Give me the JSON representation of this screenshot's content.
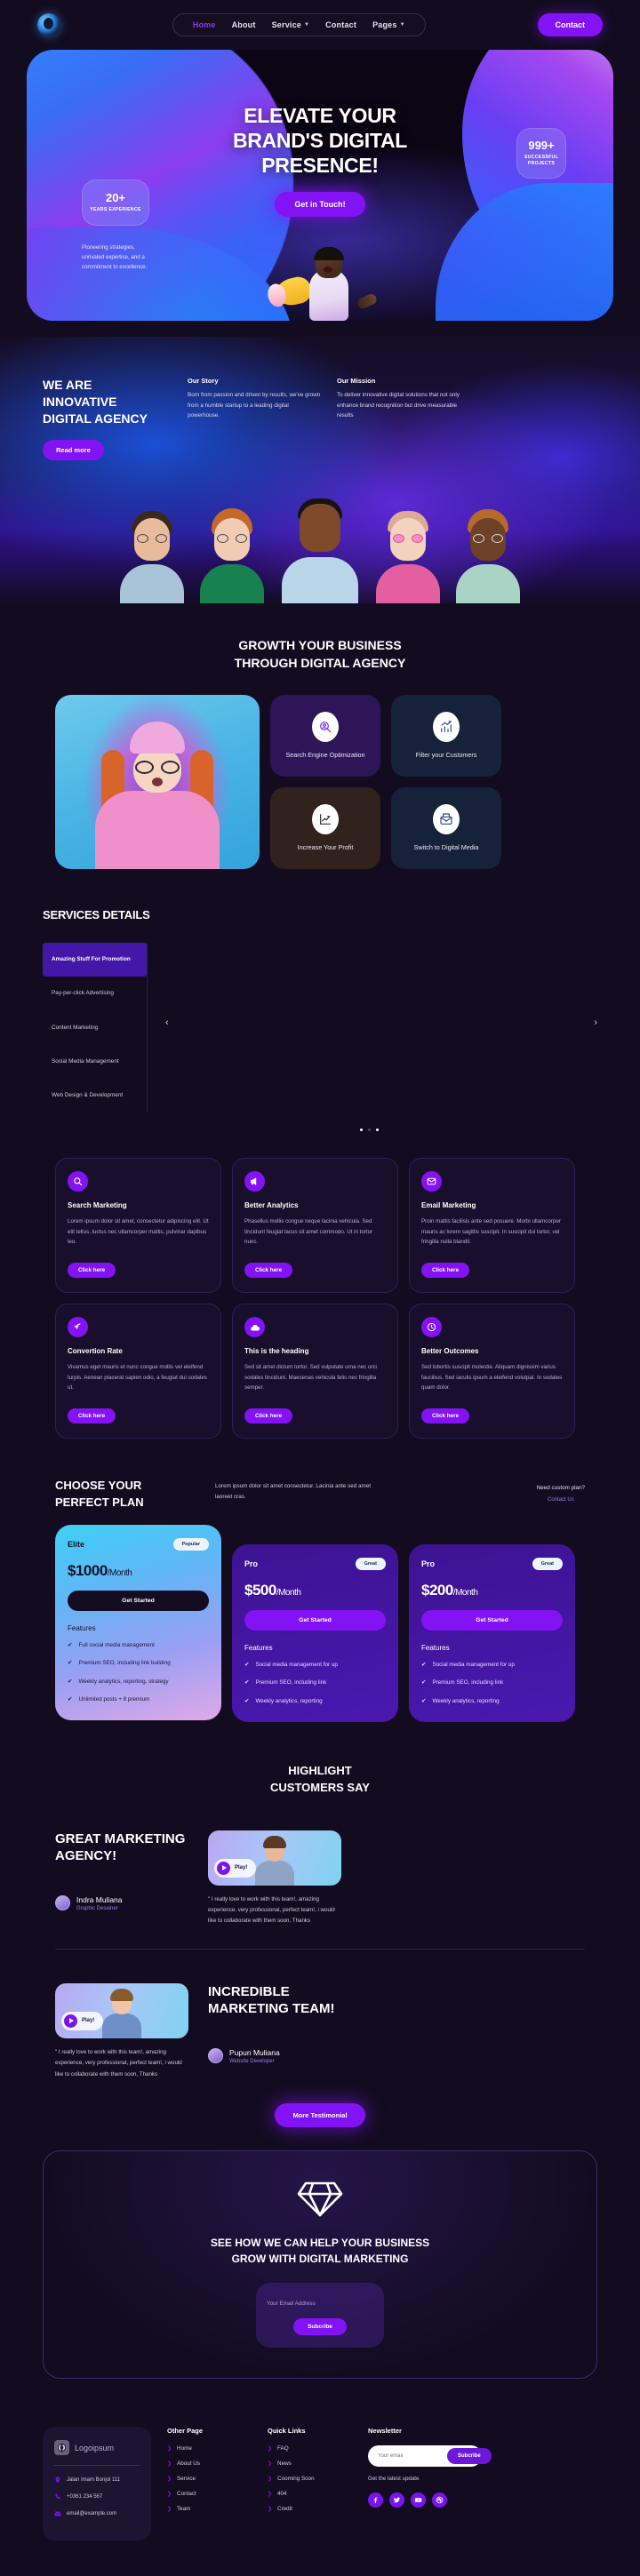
{
  "header": {
    "logo_name": "agency-logo",
    "nav": [
      {
        "label": "Home",
        "active": true,
        "caret": false
      },
      {
        "label": "About",
        "active": false,
        "caret": false
      },
      {
        "label": "Service",
        "active": false,
        "caret": true
      },
      {
        "label": "Contact",
        "active": false,
        "caret": false
      },
      {
        "label": "Pages",
        "active": false,
        "caret": true
      }
    ],
    "cta_label": "Contact"
  },
  "hero": {
    "title_line1": "ELEVATE YOUR",
    "title_line2": "BRAND'S DIGITAL",
    "title_line3": "PRESENCE!",
    "button": "Get in Touch!",
    "stat_projects_num": "999+",
    "stat_projects_label": "SUCCESSFUL PROJECTS",
    "stat_years_num": "20+",
    "stat_years_label": "YEARS EXPERIENCE",
    "subtext": "Pioneering strategies, unrivaled expertise, and a commitment to excellence."
  },
  "about": {
    "heading_l1": "WE ARE",
    "heading_l2": "INNOVATIVE",
    "heading_l3": "DIGITAL AGENCY",
    "button": "Read more",
    "columns": [
      {
        "title": "Our Story",
        "text": "Born from passion and driven by results, we've grown from a humble startup to a leading digital powerhouse."
      },
      {
        "title": "Our Mission",
        "text": "To deliver innovative digital solutions that not only enhance brand recognition but drive measurable results"
      }
    ]
  },
  "growth": {
    "title_l1": "GROWTH YOUR BUSINESS",
    "title_l2": "THROUGH DIGITAL AGENCY",
    "cards": [
      {
        "label": "Search Engine Optimization",
        "icon": "magnify-person-icon"
      },
      {
        "label": "Filter your Customers",
        "icon": "bar-chart-growth-icon"
      },
      {
        "label": "Increase Your Profit",
        "icon": "line-chart-up-icon"
      },
      {
        "label": "Switch to Digital Media",
        "icon": "envelope-doc-icon"
      }
    ]
  },
  "services_details": {
    "title": "SERVICES DETAILS",
    "items": [
      {
        "label": "Amazing Stuff For Promotion",
        "active": true
      },
      {
        "label": "Pay-per-click Advertising",
        "active": false
      },
      {
        "label": "Content Marketing",
        "active": false
      },
      {
        "label": "Social Media Management",
        "active": false
      },
      {
        "label": "Web Design & Development",
        "active": false
      }
    ],
    "prev_icon": "‹",
    "next_icon": "›"
  },
  "service_cards": [
    {
      "icon": "search-icon",
      "title": "Search Marketing",
      "text": "Lorem ipsum dolor sit amet, consectetur adipiscing elit. Ut elit tellus, luctus nec ullamcorper mattis, pulvinar dapibus leo.",
      "button": "Click here"
    },
    {
      "icon": "megaphone-icon",
      "title": "Better Analytics",
      "text": "Phasellus mollis congue neque lacinia vehicula. Sed tincidunt feugiat lacus sit amet commodo. Ut in tortor nunc.",
      "button": "Click here"
    },
    {
      "icon": "envelope-icon",
      "title": "Email Marketing",
      "text": "Proin mattis facilisis ante sed posuere. Morbi ullamcorper mauris ac lorem sagittis suscipit. In suscipit dui tortor, vel fringilla nulla blandit.",
      "button": "Click here"
    },
    {
      "icon": "rocket-icon",
      "title": "Convertion Rate",
      "text": "Vivamus eget mauris et nunc congue mollis vel eleifend turpis. Aenean placerat sapien odio, a feugiat dui sodales ut.",
      "button": "Click here"
    },
    {
      "icon": "cloud-icon",
      "title": "This is the heading",
      "text": "Sed sit amet dictum tortor. Sed vulputate urna nec orci sodales tincidunt. Maecenas vehicula felis nec fringilla semper.",
      "button": "Click here"
    },
    {
      "icon": "clock-icon",
      "title": "Better Outcomes",
      "text": "Sed lobortis suscipit molestie. Aliquam dignissim varius faucibus. Sed iaculis ipsum a eleifend volutpat. In sodales quam dolor.",
      "button": "Click here"
    }
  ],
  "pricing": {
    "title_l1": "CHOOSE YOUR",
    "title_l2": "PERFECT PLAN",
    "description": "Lorem ipsum dolor sit amet consectetur. Lacinia ante sed amet laoreet cras.",
    "custom_question": "Need custom plan?",
    "custom_link": "Contact Us",
    "features_label": "Features",
    "plans": [
      {
        "name": "Elite",
        "badge": "Popular",
        "price": "$1000",
        "period": "/Month",
        "button": "Get Started",
        "features": [
          "Full social media management",
          "Premium SEO, including link building",
          "Weekly analytics, reporting, strategy",
          "Unlimited posts + 8 premium"
        ]
      },
      {
        "name": "Pro",
        "badge": "Great",
        "price": "$500",
        "period": "/Month",
        "button": "Get Started",
        "features": [
          "Social media management for up",
          "Premium SEO, including link",
          "Weekly analytics, reporting"
        ]
      },
      {
        "name": "Pro",
        "badge": "Great",
        "price": "$200",
        "period": "/Month",
        "button": "Get Started",
        "features": [
          "Social media management for up",
          "Premium SEO, including link",
          "Weekly analytics, reporting"
        ]
      }
    ]
  },
  "testimonials": {
    "title_l1": "HIGHLIGHT",
    "title_l2": "CUSTOMERS SAY",
    "play_label": "Play!",
    "items": [
      {
        "heading": "GREAT MARKETING AGENCY!",
        "name": "Indra Muliana",
        "role": "Graphic Desainer",
        "quote": "\" I really love to work with this team!, amazing experience, very professional, perfect team!, i would like to collaborate with them soon, Thanks"
      },
      {
        "heading": "INCREDIBLE MARKETING TEAM!",
        "name": "Pupun Muliana",
        "role": "Website Developer",
        "quote": "\" I really love to work with this team!, amazing experience, very professional, perfect team!, i would like to collaborate with them soon, Thanks"
      }
    ],
    "more_button": "More Testimonial"
  },
  "cta": {
    "icon": "diamond-icon",
    "heading_l1": "SEE HOW WE CAN HELP YOUR BUSINESS",
    "heading_l2": "GROW WITH DIGITAL MARKETING",
    "placeholder": "Your Email Address",
    "button": "Subcribe"
  },
  "footer": {
    "brand": "Logoipsum",
    "address": "Jalan Imam Bonjol 111",
    "phone": "+0361 234 567",
    "email": "email@example.com",
    "other_page_title": "Other Page",
    "other_page": [
      "Home",
      "About Us",
      "Service",
      "Contact",
      "Team"
    ],
    "quick_links_title": "Quick Links",
    "quick_links": [
      "FAQ",
      "News",
      "Cooming Soon",
      "404",
      "Credit"
    ],
    "newsletter_title": "Newsletter",
    "newsletter_placeholder": "Your email",
    "newsletter_button": "Subcribe",
    "newsletter_note": "Get the latest update",
    "socials": [
      "facebook-icon",
      "twitter-icon",
      "youtube-icon",
      "dribbble-icon"
    ]
  },
  "colors": {
    "accent": "#8312f4",
    "bg": "#130c20",
    "card": "#190f2c"
  }
}
